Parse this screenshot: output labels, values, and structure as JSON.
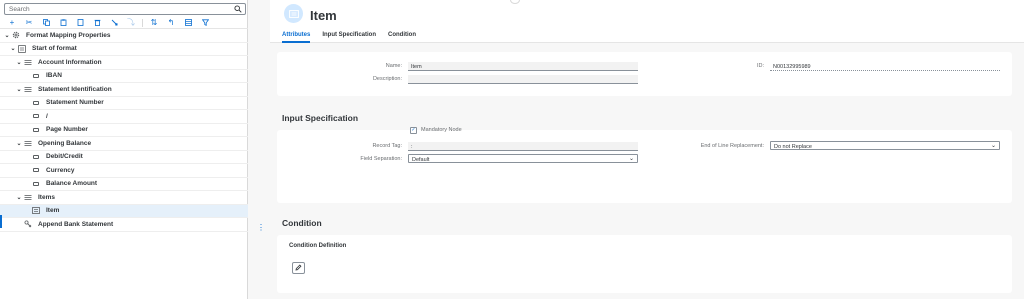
{
  "search": {
    "placeholder": "Search"
  },
  "toolbar": {
    "buttons": [
      "add-icon",
      "cut-icon",
      "copy-icon",
      "paste-icon",
      "duplicate-icon",
      "delete-icon",
      "move-icon",
      "move-down-icon",
      "sort-ascending-icon",
      "expand-icon",
      "table-icon",
      "filter-icon"
    ]
  },
  "tree": {
    "rows": [
      {
        "label": "Format Mapping Properties",
        "icon": "gear-icon"
      },
      {
        "label": "Start of format",
        "icon": "group-icon"
      },
      {
        "label": "Account Information",
        "icon": "list-icon"
      },
      {
        "label": "IBAN",
        "icon": "field-icon"
      },
      {
        "label": "Statement Identification",
        "icon": "list-icon"
      },
      {
        "label": "Statement Number",
        "icon": "field-icon"
      },
      {
        "label": "/",
        "icon": "field-icon"
      },
      {
        "label": "Page Number",
        "icon": "field-icon"
      },
      {
        "label": "Opening Balance",
        "icon": "list-icon"
      },
      {
        "label": "Debit/Credit",
        "icon": "field-icon"
      },
      {
        "label": "Currency",
        "icon": "field-icon"
      },
      {
        "label": "Balance Amount",
        "icon": "field-icon"
      },
      {
        "label": "Items",
        "icon": "list-icon"
      },
      {
        "label": "Item",
        "icon": "list-icon"
      },
      {
        "label": "Append Bank Statement",
        "icon": "append-icon"
      }
    ]
  },
  "header": {
    "title": "Item",
    "tabs": [
      "Attributes",
      "Input Specification",
      "Condition"
    ]
  },
  "attributes": {
    "name_label": "Name:",
    "name_value": "Item",
    "description_label": "Description:",
    "description_value": "",
    "id_label": "ID:",
    "id_value": "N00132995989"
  },
  "input_spec": {
    "section_title": "Input Specification",
    "record_tag_label": "Record Tag:",
    "record_tag_value": ":",
    "field_sep_label": "Field Separation:",
    "field_sep_value": "Default",
    "eol_label": "End of Line Replacement:",
    "eol_value": "Do not Replace",
    "mandatory_label": "Mandatory Node",
    "mandatory_checked": true
  },
  "condition": {
    "section_title": "Condition",
    "definition_label": "Condition Definition"
  },
  "colors": {
    "accent": "#0a6ed1",
    "selected_row": "#e5f0fa"
  }
}
